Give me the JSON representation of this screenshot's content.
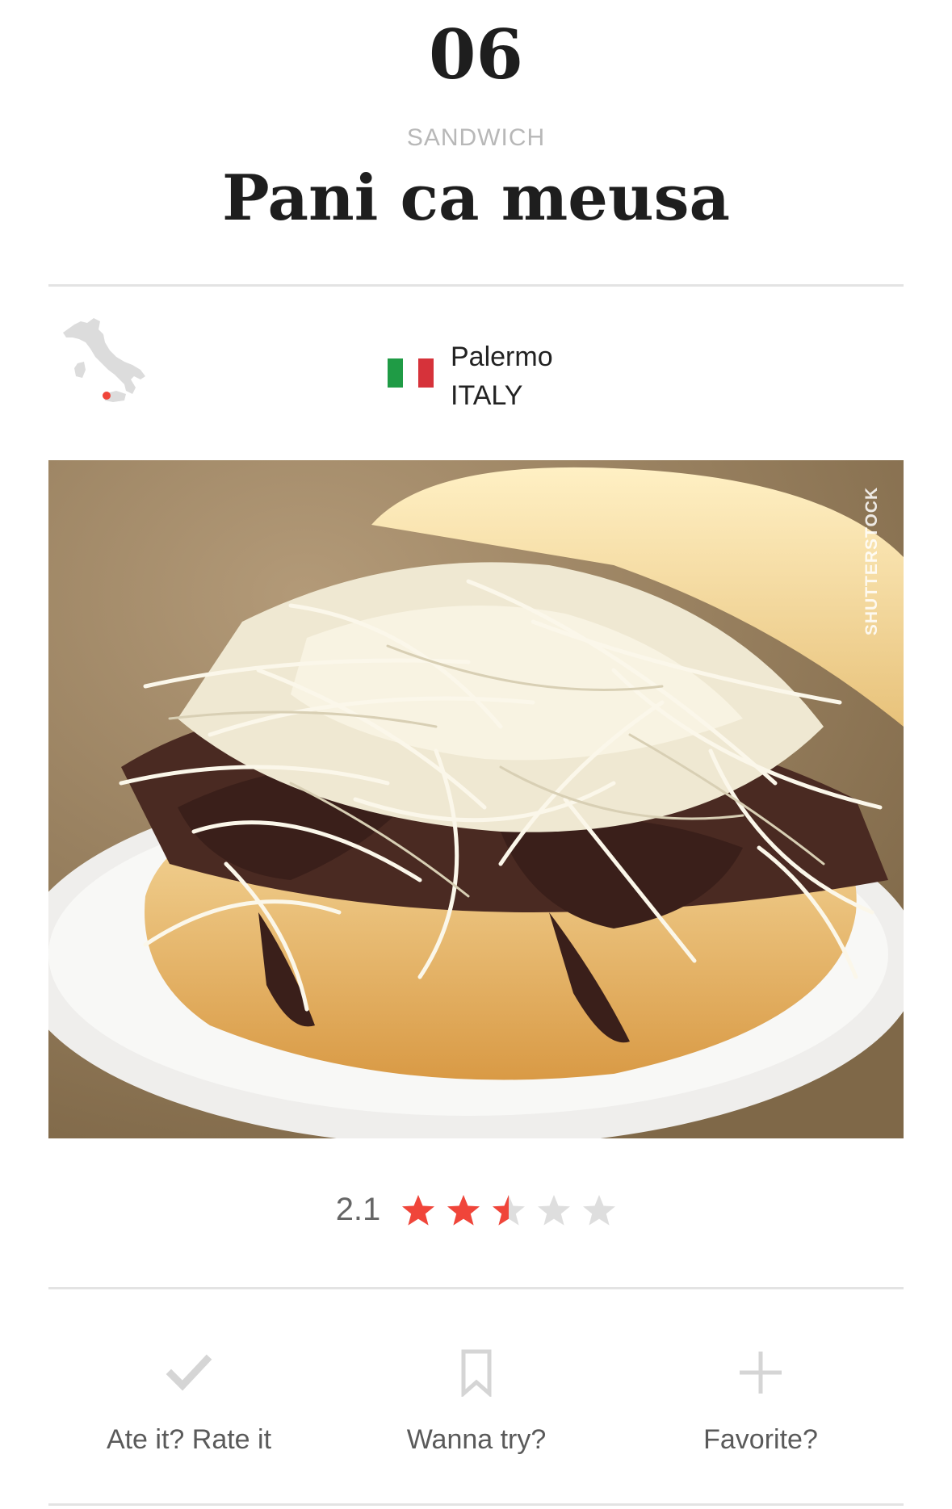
{
  "header": {
    "rank": "06",
    "category": "SANDWICH",
    "title": "Pani ca meusa"
  },
  "location": {
    "city": "Palermo",
    "country": "ITALY",
    "map_icon": "italy-map-icon",
    "flag_icon": "italy-flag-icon",
    "flag_colors": [
      "#1f9b45",
      "#ffffff",
      "#d6323a"
    ]
  },
  "photo": {
    "description_icon": "food-photo",
    "watermark": "SHUTTERSTOCK"
  },
  "rating": {
    "value": "2.1",
    "max": 5,
    "score": 2.5,
    "filled_color": "#f0453a",
    "empty_color": "#dedede"
  },
  "actions": [
    {
      "label": "Ate it? Rate it",
      "icon": "check-icon"
    },
    {
      "label": "Wanna try?",
      "icon": "bookmark-icon"
    },
    {
      "label": "Favorite?",
      "icon": "plus-icon"
    }
  ],
  "colors": {
    "divider": "#e3e3e3",
    "icon_gray": "#d5d5d5",
    "accent": "#f0453a"
  }
}
